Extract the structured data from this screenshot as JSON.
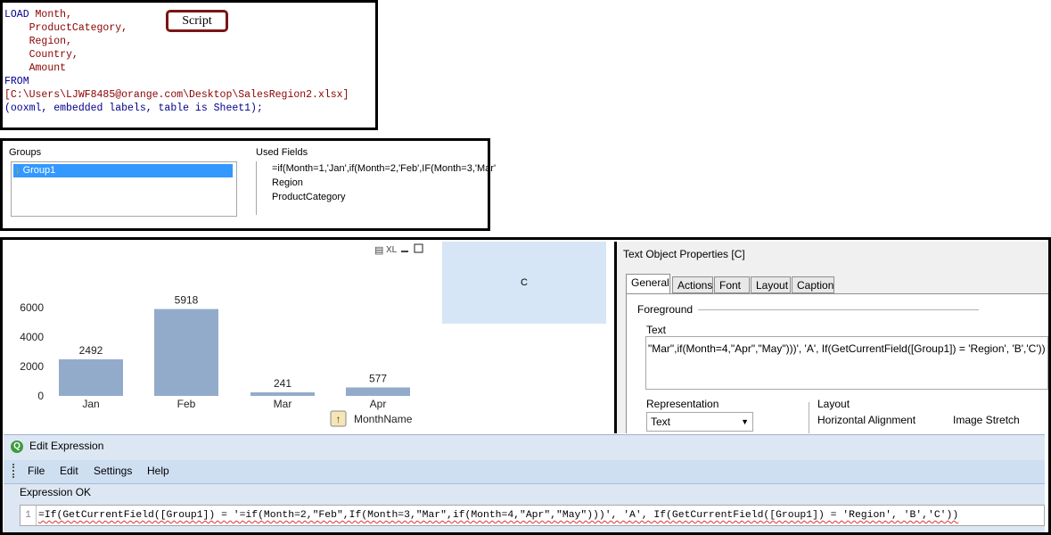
{
  "script": {
    "tag": "Script",
    "load_kw": "LOAD",
    "fields": [
      "Month,",
      "ProductCategory,",
      "Region,",
      "Country,",
      "Amount"
    ],
    "from_kw": "FROM",
    "path": "[C:\\Users\\LJWF8485@orange.com\\Desktop\\SalesRegion2.xlsx]",
    "format": "(ooxml, embedded labels, table is Sheet1);"
  },
  "groups": {
    "groups_label": "Groups",
    "group_item": "Group1",
    "used_fields_label": "Used Fields",
    "used_fields": [
      "=if(Month=1,'Jan',if(Month=2,'Feb',IF(Month=3,'Mar'",
      "Region",
      "ProductCategory"
    ]
  },
  "chart": {
    "caption_icons": "XL",
    "dimension_label": "MonthName",
    "colors": {
      "bar": "#93abcb"
    }
  },
  "chart_data": {
    "type": "bar",
    "categories": [
      "Jan",
      "Feb",
      "Mar",
      "Apr"
    ],
    "values": [
      2492,
      5918,
      241,
      577
    ],
    "yticks": [
      0,
      2000,
      4000,
      6000
    ],
    "ylim": [
      0,
      6500
    ],
    "title": "",
    "xlabel": "MonthName",
    "ylabel": ""
  },
  "text_object": {
    "label": "C"
  },
  "props": {
    "title": "Text Object Properties [C]",
    "tabs": [
      "General",
      "Actions",
      "Font",
      "Layout",
      "Caption"
    ],
    "foreground_label": "Foreground",
    "text_label": "Text",
    "text_value": "\"Mar\",if(Month=4,\"Apr\",\"May\")))', 'A', If(GetCurrentField([Group1]) = 'Region', 'B','C'))",
    "representation_label": "Representation",
    "representation_value": "Text",
    "layout_label": "Layout",
    "halign_label": "Horizontal Alignment",
    "image_stretch_label": "Image Stretch"
  },
  "expression": {
    "title": "Edit Expression",
    "app_icon_letter": "Q",
    "menu": [
      "File",
      "Edit",
      "Settings",
      "Help"
    ],
    "status": "Expression OK",
    "line_number": "1",
    "text": "=If(GetCurrentField([Group1]) = '=if(Month=2,\"Feb\",If(Month=3,\"Mar\",if(Month=4,\"Apr\",\"May\")))', 'A', If(GetCurrentField([Group1]) = 'Region', 'B','C'))"
  }
}
